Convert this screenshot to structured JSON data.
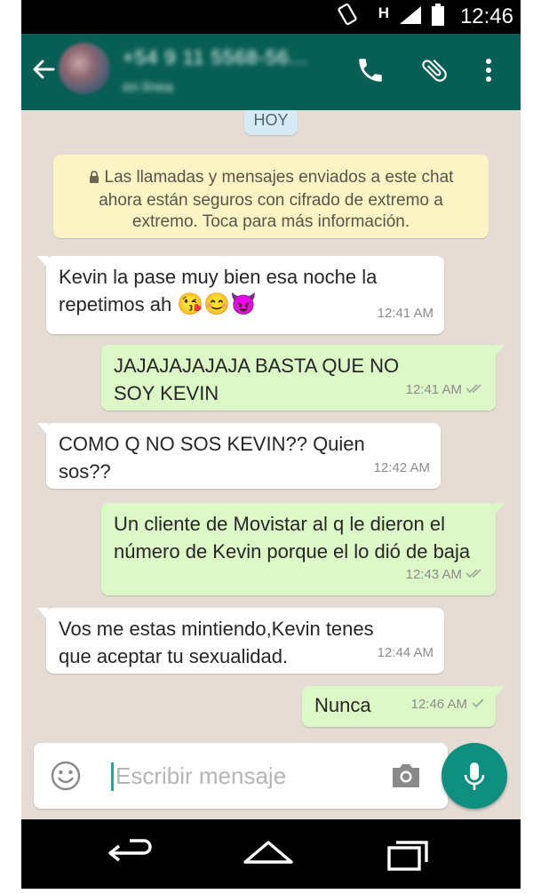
{
  "status_bar": {
    "time": "12:46",
    "network_label": "H",
    "icons": [
      "rotation-lock-icon",
      "signal-icon",
      "battery-icon"
    ]
  },
  "app_bar": {
    "contact_name": "+54 9 11 5568-56...",
    "contact_status": "en línea",
    "icons": [
      "back-arrow-icon",
      "phone-call-icon",
      "paperclip-icon",
      "more-vert-icon"
    ],
    "color": "#075e54"
  },
  "chat": {
    "date_chip": "HOY",
    "system_notice": "Las llamadas y mensajes enviados a este chat ahora están seguros con cifrado de extremo a extremo. Toca para más información.",
    "messages": [
      {
        "direction": "incoming",
        "text": "Kevin la pase muy bien esa noche la repetimos ah",
        "emoji": "😘😊😈",
        "time": "12:41 AM"
      },
      {
        "direction": "outgoing",
        "text": "JAJAJAJAJAJA BASTA QUE NO SOY KEVIN",
        "time": "12:41 AM",
        "status": "read"
      },
      {
        "direction": "incoming",
        "text": "COMO Q NO SOS KEVIN??  Quien sos??",
        "time": "12:42 AM"
      },
      {
        "direction": "outgoing",
        "text": "Un cliente de Movistar al q le dieron el número de Kevin porque el lo dió de baja",
        "time": "12:43 AM",
        "status": "read"
      },
      {
        "direction": "incoming",
        "text": "Vos me estas mintiendo,Kevin tenes que aceptar tu sexualidad.",
        "time": "12:44 AM"
      },
      {
        "direction": "outgoing",
        "text": "Nunca",
        "time": "12:46 AM",
        "status": "sent"
      }
    ],
    "colors": {
      "incoming": "#ffffff",
      "outgoing": "#dcf8c6",
      "background": "#e5ddd5",
      "notice": "#fdf4c5"
    }
  },
  "input": {
    "placeholder": "Escribir mensaje",
    "icons": [
      "emoji-icon",
      "camera-icon",
      "microphone-icon"
    ],
    "accent": "#0e8f80"
  },
  "nav_bar": {
    "icons": [
      "back-icon",
      "home-icon",
      "recents-icon"
    ]
  }
}
